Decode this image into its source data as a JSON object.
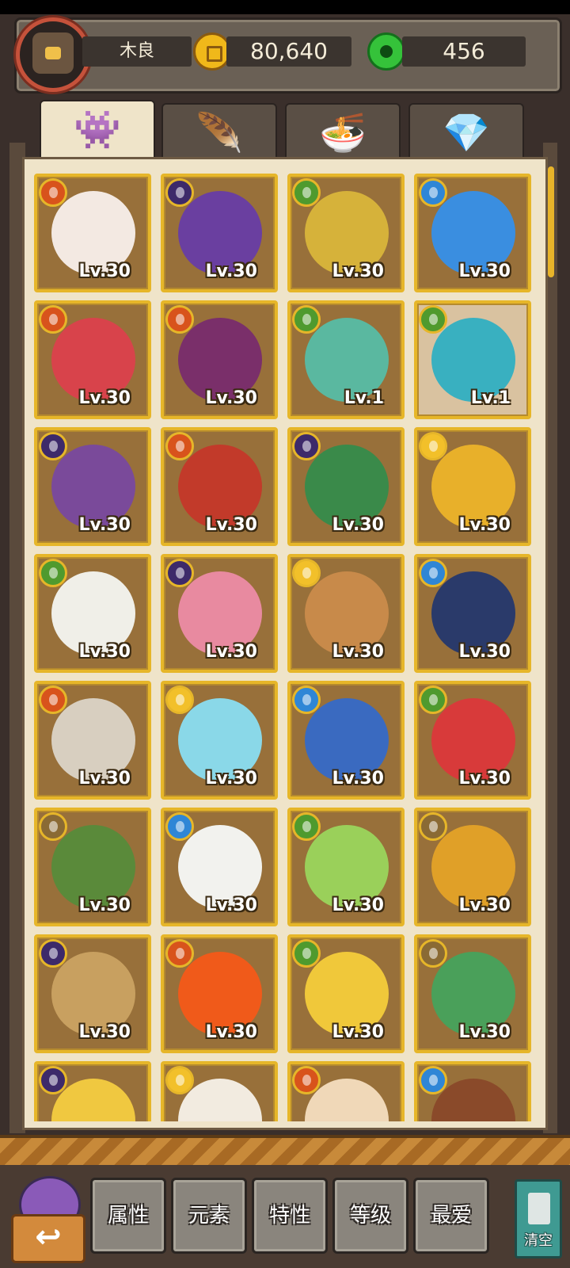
{
  "header": {
    "player_name": "木良",
    "coins": "80,640",
    "gems": "456"
  },
  "tabs": [
    {
      "icon": "monster-icon",
      "glyph": "👾",
      "active": true
    },
    {
      "icon": "peacock-feather-icon",
      "glyph": "🪶",
      "active": false
    },
    {
      "icon": "food-bowl-icon",
      "glyph": "🍜",
      "active": false
    },
    {
      "icon": "crystal-icon",
      "glyph": "💎",
      "active": false
    }
  ],
  "cards": [
    {
      "element": "fire",
      "item": "heart-card-icon",
      "color": "#f3e9e2",
      "level": "Lv.30"
    },
    {
      "element": "dark",
      "item": "sorceress-icon",
      "color": "#6a3fa0",
      "level": "Lv.30"
    },
    {
      "element": "leaf",
      "item": "golden-bow-icon",
      "color": "#d6b23a",
      "level": "Lv.30"
    },
    {
      "element": "water",
      "item": "water-orb-icon",
      "color": "#3a8ee0",
      "level": "Lv.30"
    },
    {
      "element": "fire",
      "item": "virgo-star-icon",
      "color": "#d8434b",
      "level": "Lv.30"
    },
    {
      "element": "fire",
      "item": "queen-icon",
      "color": "#7a2f6a",
      "level": "Lv.30"
    },
    {
      "element": "leaf",
      "item": "green-chef-icon",
      "color": "#5ab8a0",
      "level": "Lv.1"
    },
    {
      "element": "leaf",
      "item": "dragon-icon",
      "color": "#39b0c0",
      "level": "Lv.1"
    },
    {
      "element": "dark",
      "item": "cupcake-icon",
      "color": "#7a4a9a",
      "level": "Lv.30"
    },
    {
      "element": "fire",
      "item": "drum-icon",
      "color": "#c23a2a",
      "level": "Lv.30"
    },
    {
      "element": "dark",
      "item": "bearded-man-icon",
      "color": "#3a8a4a",
      "level": "Lv.30"
    },
    {
      "element": "sun",
      "item": "gold-ingot-icon",
      "color": "#e8b02a",
      "level": "Lv.30"
    },
    {
      "element": "leaf",
      "item": "sheep-icon",
      "color": "#f0efe8",
      "level": "Lv.30"
    },
    {
      "element": "dark",
      "item": "cake-icon",
      "color": "#e88aa0",
      "level": "Lv.30"
    },
    {
      "element": "sun",
      "item": "swordsman-icon",
      "color": "#c88a4a",
      "level": "Lv.30"
    },
    {
      "element": "water",
      "item": "scholar-icon",
      "color": "#2a3a6a",
      "level": "Lv.30"
    },
    {
      "element": "fire",
      "item": "clam-icon",
      "color": "#d8cfc0",
      "level": "Lv.30"
    },
    {
      "element": "sun",
      "item": "ice-cube-icon",
      "color": "#8ad8e8",
      "level": "Lv.30"
    },
    {
      "element": "water",
      "item": "snowman-icon",
      "color": "#3a6ac0",
      "level": "Lv.30"
    },
    {
      "element": "leaf",
      "item": "santa-hat-icon",
      "color": "#d83a3a",
      "level": "Lv.30"
    },
    {
      "element": "earth",
      "item": "green-rock-icon",
      "color": "#5a8a3a",
      "level": "Lv.30"
    },
    {
      "element": "water",
      "item": "deer-icon",
      "color": "#f2f2ee",
      "level": "Lv.30"
    },
    {
      "element": "leaf",
      "item": "cat-leaf-icon",
      "color": "#9ad05a",
      "level": "Lv.30"
    },
    {
      "element": "earth",
      "item": "ginkgo-icon",
      "color": "#e0a028",
      "level": "Lv.30"
    },
    {
      "element": "dark",
      "item": "boat-man-icon",
      "color": "#c8a060",
      "level": "Lv.30"
    },
    {
      "element": "fire",
      "item": "flame-icon",
      "color": "#f05a1a",
      "level": "Lv.30"
    },
    {
      "element": "leaf",
      "item": "wheat-icon",
      "color": "#f0c83a",
      "level": "Lv.30"
    },
    {
      "element": "earth",
      "item": "cactus-icon",
      "color": "#4aa05a",
      "level": "Lv.30"
    },
    {
      "element": "dark",
      "item": "chick-icon",
      "color": "#f0c840",
      "level": ""
    },
    {
      "element": "sun",
      "item": "lamb-icon",
      "color": "#f2ebe0",
      "level": ""
    },
    {
      "element": "fire",
      "item": "bun-icon",
      "color": "#f0d8b8",
      "level": ""
    },
    {
      "element": "water",
      "item": "cannon-icon",
      "color": "#8a4a2a",
      "level": ""
    }
  ],
  "filters": [
    {
      "label": "属性"
    },
    {
      "label": "元素"
    },
    {
      "label": "特性"
    },
    {
      "label": "等级"
    },
    {
      "label": "最爱"
    }
  ],
  "back_button": {
    "icon": "back-arrow-icon",
    "glyph": "↩"
  },
  "clear_button": {
    "label": "清空",
    "icon": "trash-can-icon"
  }
}
